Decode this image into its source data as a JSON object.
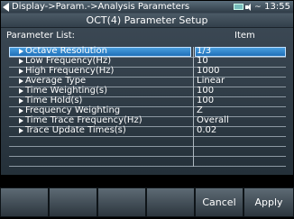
{
  "titlebar": {
    "breadcrumb": "Display->Param.->Analysis Parameters",
    "clock": "13:55",
    "wave_glyph": "~"
  },
  "heading": "OCT(4) Parameter Setup",
  "list_label": "Parameter  List:",
  "item_label": "Item",
  "parameters": [
    {
      "name": "Octave Resolution",
      "value": "1/3"
    },
    {
      "name": "Low Frequency(Hz)",
      "value": "10"
    },
    {
      "name": "High Frequency(Hz)",
      "value": "1000"
    },
    {
      "name": "Average Type",
      "value": "Linear"
    },
    {
      "name": "Time Weighting(s)",
      "value": "100"
    },
    {
      "name": "Time Hold(s)",
      "value": "100"
    },
    {
      "name": "Frequency Weighting",
      "value": "Z"
    },
    {
      "name": "Time Trace Frequency(Hz)",
      "value": "Overall"
    },
    {
      "name": "Trace Update Times(s)",
      "value": "0.02"
    }
  ],
  "selected_index": 0,
  "softkeys": {
    "k1": "",
    "k2": "",
    "k3": "",
    "k4": "",
    "cancel": "Cancel",
    "apply": "Apply"
  },
  "colors": {
    "selection": "#2f86d0",
    "panel": "#2f3c47"
  }
}
